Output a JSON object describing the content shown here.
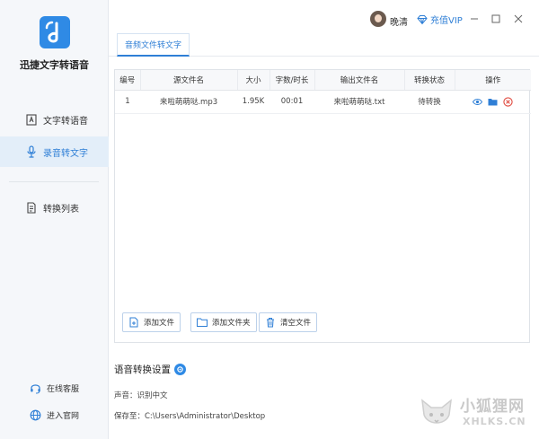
{
  "app": {
    "name": "迅捷文字转语音"
  },
  "sidebar": {
    "items": [
      {
        "label": "文字转语音",
        "icon": "text-to-speech-icon",
        "active": false
      },
      {
        "label": "录音转文字",
        "icon": "microphone-icon",
        "active": true
      },
      {
        "label": "转换列表",
        "icon": "document-list-icon",
        "active": false
      }
    ],
    "bottom_links": [
      {
        "label": "在线客服",
        "icon": "headset-icon"
      },
      {
        "label": "进入官网",
        "icon": "globe-icon"
      }
    ]
  },
  "header": {
    "username": "晚清",
    "vip_label": "充值VIP",
    "window_controls": [
      "minimize-icon",
      "maximize-icon",
      "close-icon"
    ]
  },
  "tabs": [
    {
      "label": "音频文件转文字",
      "active": true
    }
  ],
  "table": {
    "columns": [
      "编号",
      "源文件名",
      "大小",
      "字数/时长",
      "输出文件名",
      "转换状态",
      "操作"
    ],
    "rows": [
      {
        "index": "1",
        "source": "来啦萌萌哒.mp3",
        "size": "1.95K",
        "duration": "00:01",
        "output": "来啦萌萌哒.txt",
        "status": "待转换",
        "actions": [
          "eye-icon",
          "folder-icon",
          "delete-icon"
        ]
      }
    ]
  },
  "buttons": {
    "add_file": "添加文件",
    "add_folder": "添加文件夹",
    "clear_files": "清空文件"
  },
  "settings": {
    "title": "语音转换设置",
    "voice": "声音：识别中文",
    "save_to": "保存至：C:\\Users\\Administrator\\Desktop"
  },
  "watermark": {
    "cn": "小狐狸网",
    "en": "XHLKS.CN"
  },
  "colors": {
    "accent": "#2f7fd6",
    "sidebar_bg": "#f5f7fa",
    "active_bg": "#e3eef9",
    "delete": "#e04a3f"
  }
}
